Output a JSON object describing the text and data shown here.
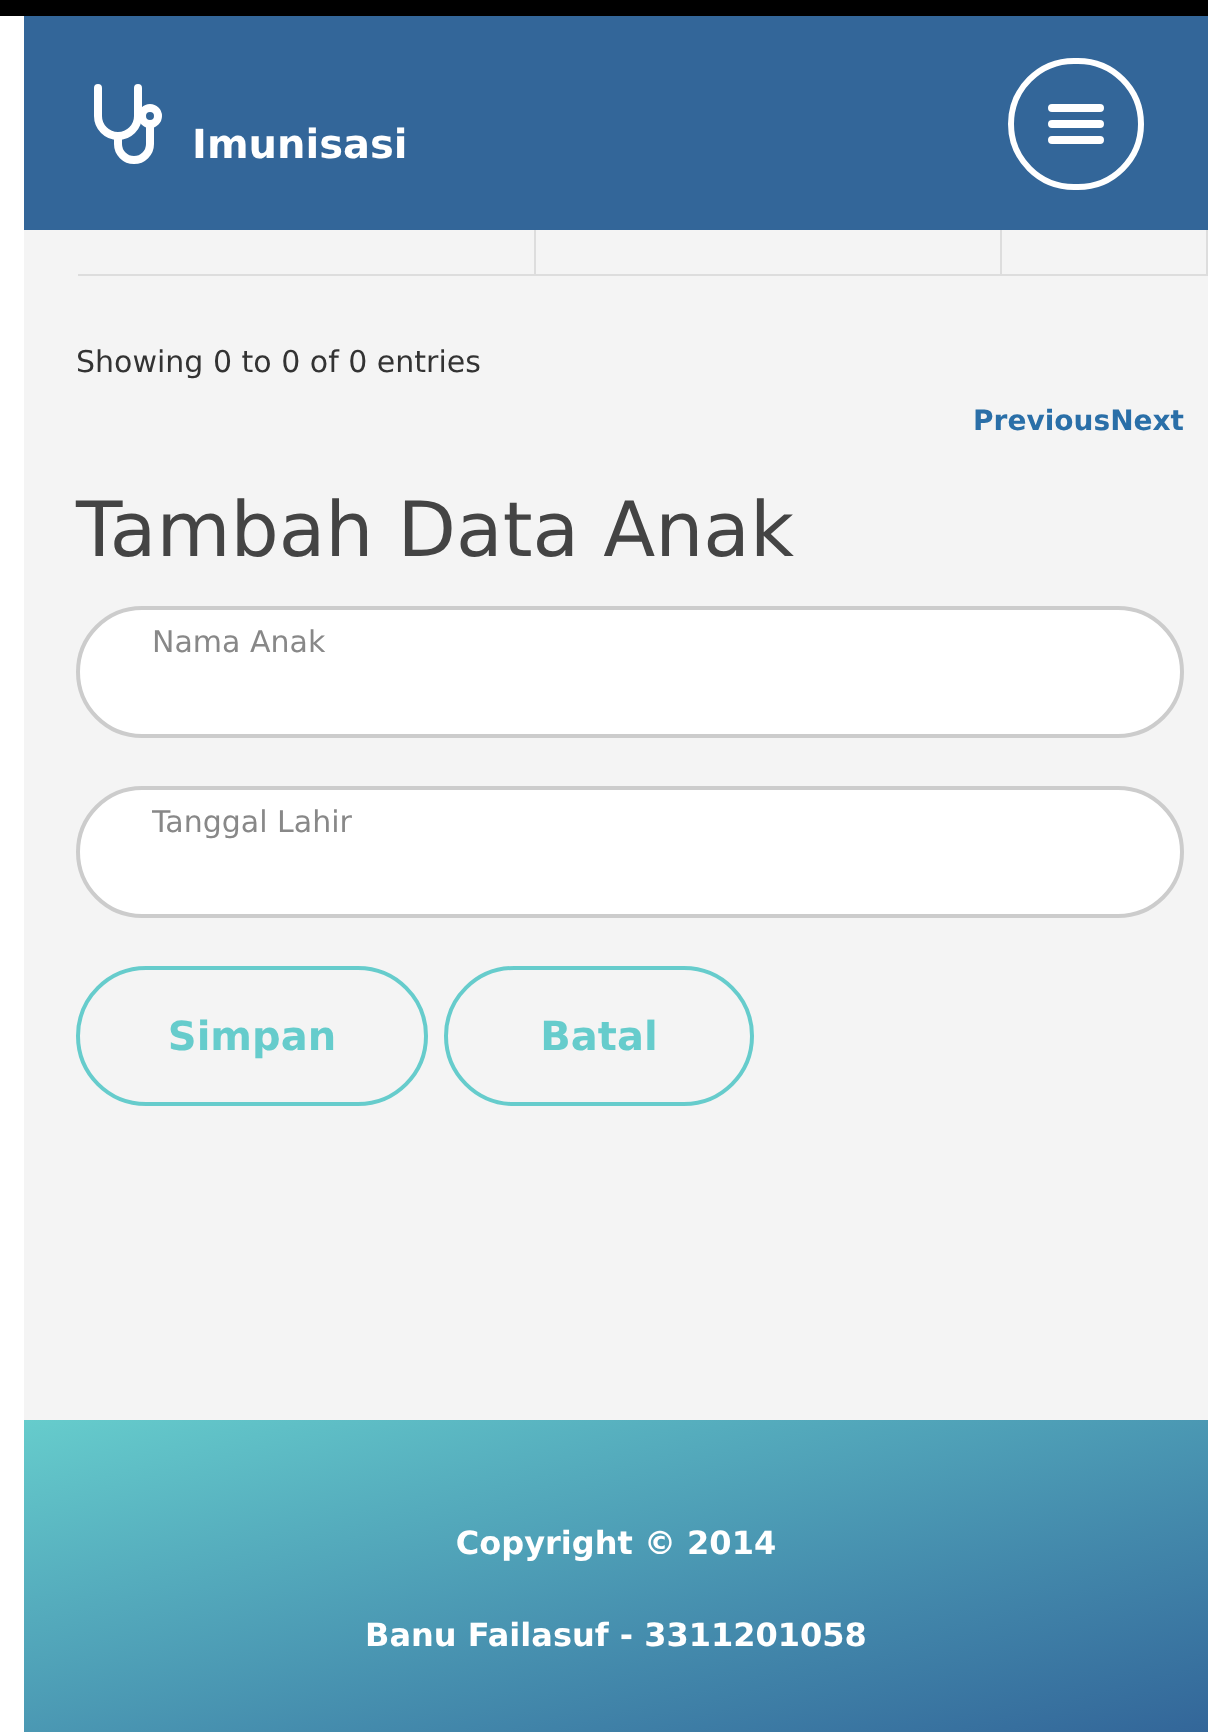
{
  "header": {
    "brand": "Imunisasi"
  },
  "info": "Showing 0 to 0 of 0 entries",
  "pagination": [
    "Previous",
    "Next"
  ],
  "form": {
    "title": "Tambah Data Anak",
    "fields": [
      {
        "placeholder": "Nama Anak"
      },
      {
        "placeholder": "Tanggal Lahir"
      }
    ],
    "buttons": [
      "Simpan",
      "Batal"
    ]
  },
  "footer": {
    "lines": [
      "Copyright © 2014",
      "Banu Failasuf - 3311201058"
    ]
  }
}
